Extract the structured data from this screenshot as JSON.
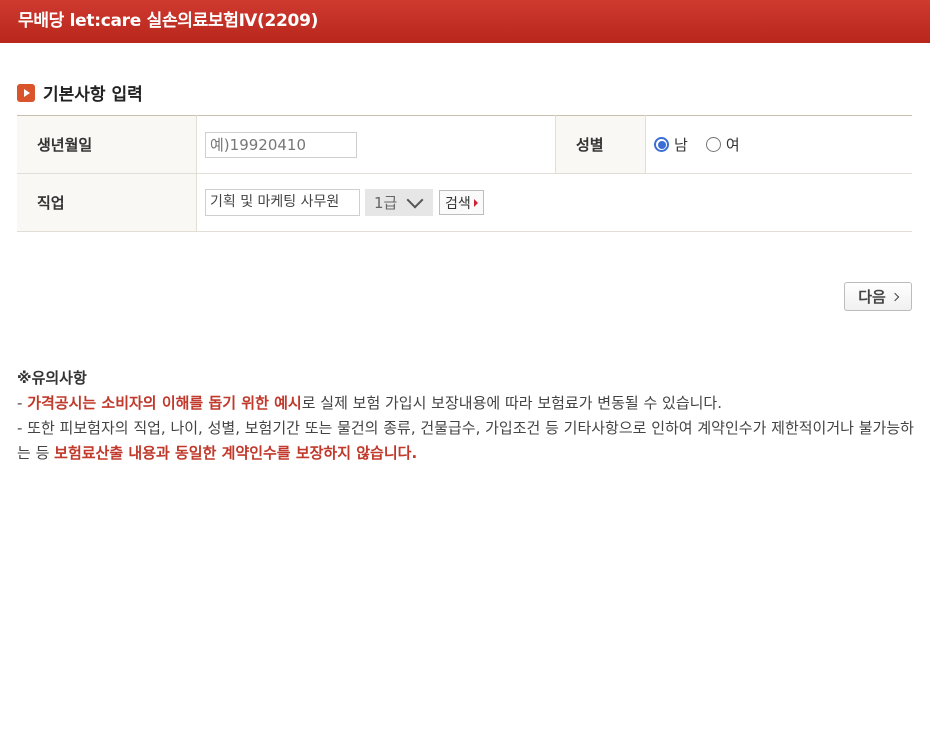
{
  "window": {
    "title": "무배당 let:care 실손의료보험Ⅳ(2209)"
  },
  "section": {
    "title": "기본사항 입력"
  },
  "form": {
    "birth_label": "생년월일",
    "birth_placeholder": "예)19920410",
    "gender_label": "성별",
    "gender_options": [
      {
        "label": "남",
        "selected": true
      },
      {
        "label": "여",
        "selected": false
      }
    ],
    "job_label": "직업",
    "job_value": "기획 및 마케팅 사무원",
    "grade_value": "1급",
    "search_label": "검색"
  },
  "next_label": "다음",
  "notes": {
    "heading": "※유의사항",
    "line1_prefix": "- ",
    "line1_bold": "가격공시는 소비자의 이해를 돕기 위한 예시",
    "line1_rest": "로 실제 보험 가입시 보장내용에 따라 보험료가 변동될 수 있습니다.",
    "line2_start": "- 또한 피보험자의 직업, 나이, 성별, 보험기간 또는 물건의 종류, 건물급수, 가입조건 등 기타사항으로 인하여 계약인수가 제한적이거나 불가능하는 등 ",
    "line2_bold": "보험료산출 내용과 동일한 계약인수를 보장하지 않습니다."
  }
}
